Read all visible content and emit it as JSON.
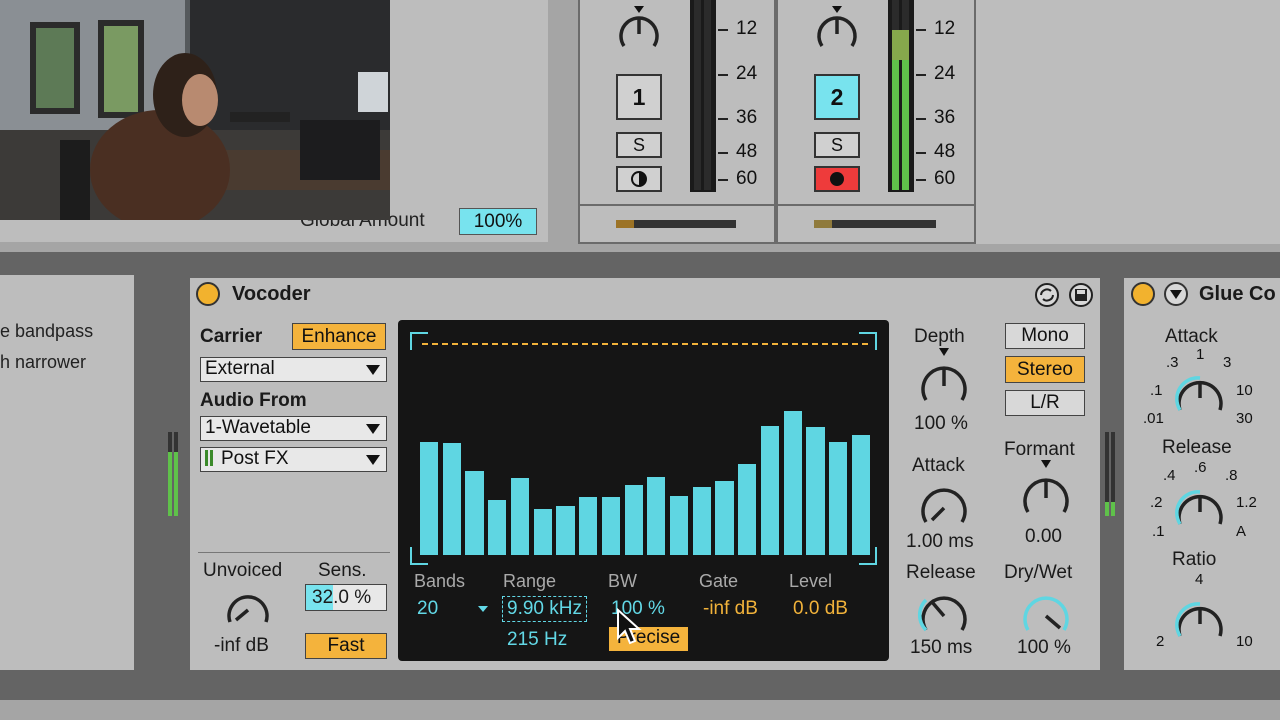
{
  "top": {
    "global_amount_label": "Global Amount",
    "global_amount_value": "100%",
    "tracks": [
      {
        "number": "1",
        "solo": "S",
        "ticks": [
          "12",
          "24",
          "36",
          "48",
          "60"
        ]
      },
      {
        "number": "2",
        "solo": "S",
        "ticks": [
          "12",
          "24",
          "36",
          "48",
          "60"
        ]
      }
    ]
  },
  "left_device": {
    "line1": "e bandpass",
    "line2": "h narrower"
  },
  "vocoder": {
    "title": "Vocoder",
    "carrier_label": "Carrier",
    "enhance_label": "Enhance",
    "carrier_value": "External",
    "audio_from_label": "Audio From",
    "audio_from_value": "1-Wavetable",
    "post_fx_value": "Post FX",
    "unvoiced_label": "Unvoiced",
    "unvoiced_value": "-inf dB",
    "sens_label": "Sens.",
    "sens_value": "32.0 %",
    "fast_label": "Fast",
    "display": {
      "bands_label": "Bands",
      "bands_value": "20",
      "range_label": "Range",
      "range_high": "9.90 kHz",
      "range_low": "215 Hz",
      "bw_label": "BW",
      "bw_value": "100 %",
      "precise_label": "Precise",
      "gate_label": "Gate",
      "gate_value": "-inf dB",
      "level_label": "Level",
      "level_value": "0.0 dB",
      "band_levels": [
        0.78,
        0.77,
        0.58,
        0.38,
        0.53,
        0.32,
        0.34,
        0.4,
        0.4,
        0.48,
        0.54,
        0.41,
        0.47,
        0.51,
        0.63,
        0.89,
        0.99,
        0.88,
        0.78,
        0.83
      ]
    },
    "depth_label": "Depth",
    "depth_value": "100 %",
    "attack_label": "Attack",
    "attack_value": "1.00 ms",
    "release_label": "Release",
    "release_value": "150 ms",
    "mono_label": "Mono",
    "stereo_label": "Stereo",
    "lr_label": "L/R",
    "formant_label": "Formant",
    "formant_value": "0.00",
    "drywet_label": "Dry/Wet",
    "drywet_value": "100 %"
  },
  "glue": {
    "title": "Glue Co",
    "attack_label": "Attack",
    "attack_scale": [
      ".01",
      ".1",
      ".3",
      "1",
      "3",
      "10",
      "30"
    ],
    "release_label": "Release",
    "release_scale": [
      ".1",
      ".2",
      ".4",
      ".6",
      ".8",
      "1.2",
      "A"
    ],
    "ratio_label": "Ratio",
    "ratio_scale": [
      "2",
      "4",
      "10"
    ]
  },
  "colors": {
    "accent_cyan": "#5fd6e2",
    "accent_orange": "#f4b33c",
    "panel": "#bdbdbd",
    "display_bg": "#151515"
  }
}
